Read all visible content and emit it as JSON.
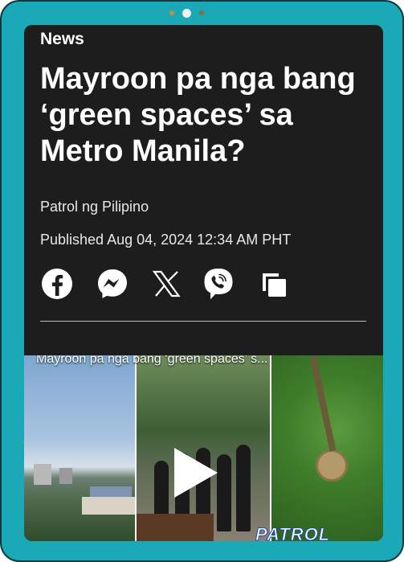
{
  "article": {
    "section": "News",
    "headline": "Mayroon pa nga bang ‘green spaces’ sa Metro Manila?",
    "author": "Patrol ng Pilipino",
    "published": "Published Aug 04, 2024 12:34 AM PHT"
  },
  "share": [
    {
      "icon": "facebook-icon"
    },
    {
      "icon": "messenger-icon"
    },
    {
      "icon": "x-icon"
    },
    {
      "icon": "viber-icon"
    },
    {
      "icon": "copy-icon"
    }
  ],
  "video": {
    "title": "Mayroon pa nga bang ‘green spaces’ s...",
    "logo": "PATROL"
  },
  "colors": {
    "device_frame": "#1ba8b7",
    "screen_bg": "#1d1d1d",
    "text": "#ffffff"
  }
}
